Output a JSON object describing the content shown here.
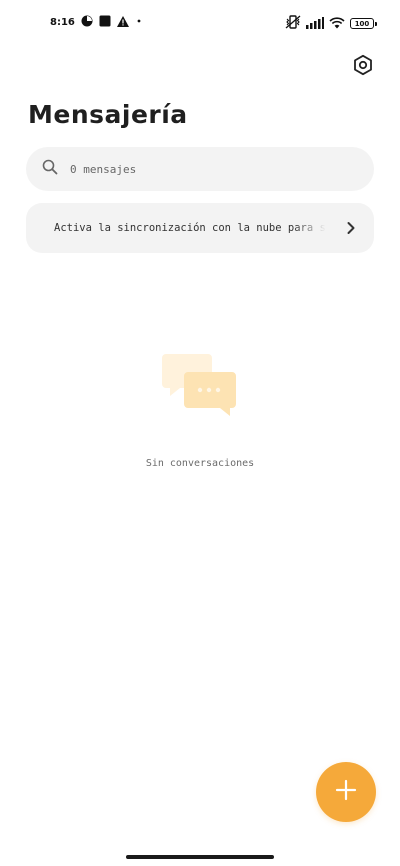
{
  "status_bar": {
    "time": "8:16",
    "battery": "100",
    "icons_left": [
      "data-saver-icon",
      "app-square-icon",
      "warning-icon",
      "dot-icon"
    ],
    "icons_right": [
      "vibrate-icon",
      "signal-icon",
      "wifi-icon",
      "battery-icon"
    ]
  },
  "header": {
    "title": "Mensajería",
    "settings_icon": "settings-hexagon-icon"
  },
  "search": {
    "placeholder": "0 mensajes",
    "icon": "search-icon"
  },
  "sync_banner": {
    "text": "Activa la sincronización con la nube para sincronizar",
    "icon": "chevron-right-icon"
  },
  "empty_state": {
    "icon": "chat-bubbles-icon",
    "text": "Sin conversaciones"
  },
  "fab": {
    "icon": "plus-icon"
  },
  "colors": {
    "accent": "#f5a93a",
    "accent_light": "#fde9c4",
    "surface": "#f3f3f3",
    "text": "#1f1f1f"
  }
}
